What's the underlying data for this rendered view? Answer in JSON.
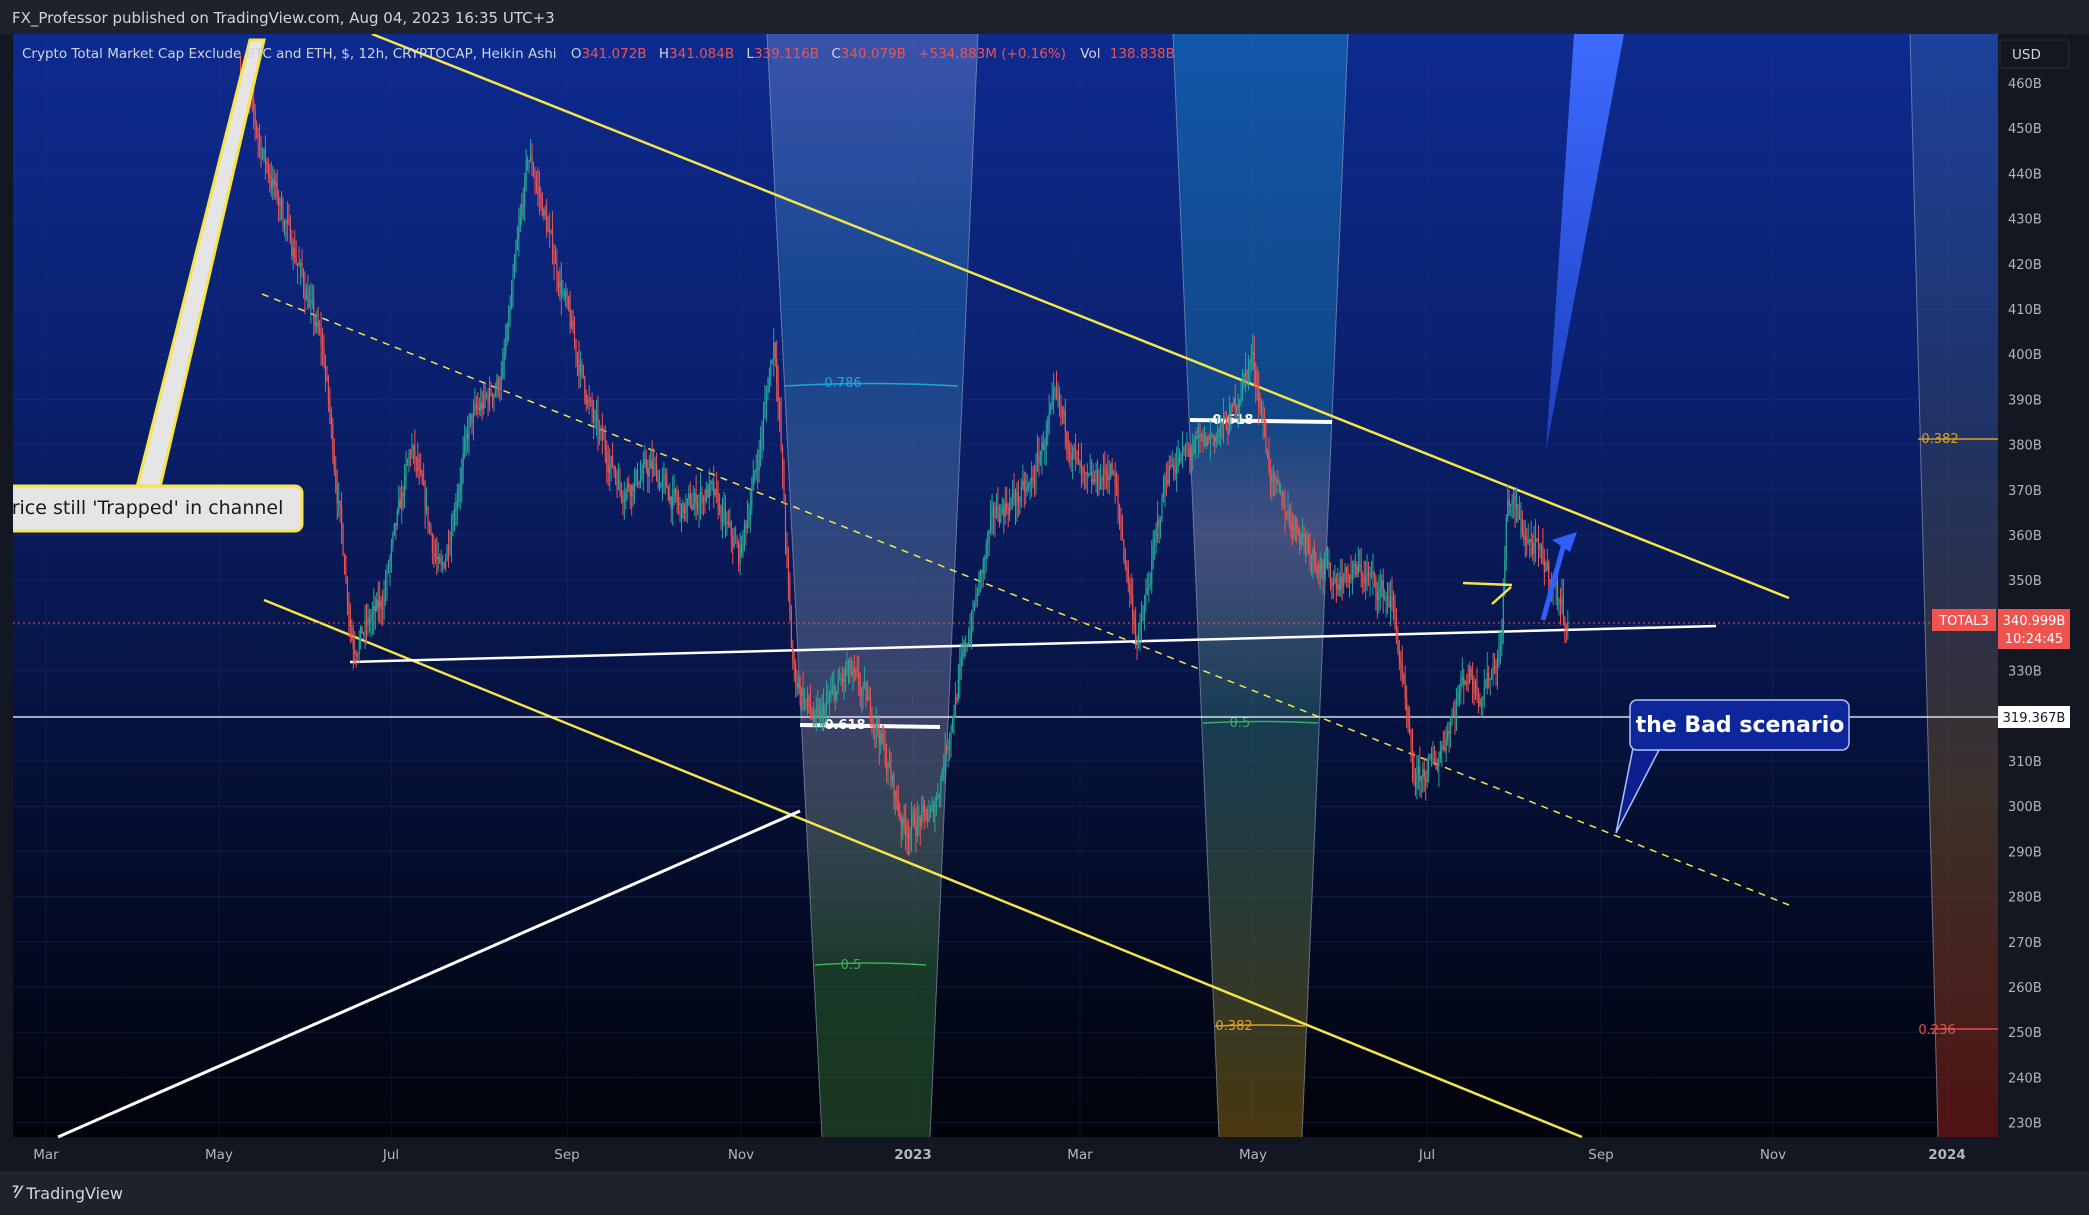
{
  "publisher": "FX_Professor published on TradingView.com, Aug 04, 2023 16:35 UTC+3",
  "footer_brand": "TradingView",
  "icons": {
    "brand": "tradingview-logo-icon"
  },
  "legend": {
    "title": "Crypto Total Market Cap Exclude BTC and ETH, $, 12h, CRYPTOCAP, Heikin Ashi",
    "o_label": "O",
    "o_value": "341.072B",
    "h_label": "H",
    "h_value": "341.084B",
    "l_label": "L",
    "l_value": "339.116B",
    "c_label": "C",
    "c_value": "340.079B",
    "change": "+534.883M (+0.16%)",
    "vol_label": "Vol",
    "vol_value": "138.838B"
  },
  "currency": "USD",
  "price_tag": {
    "symbol": "TOTAL3",
    "value": "340.999B",
    "countdown": "10:24:45"
  },
  "hline_tag": "319.367B",
  "annotations": {
    "trapped": "Price still 'Trapped' in channel",
    "bad": "the Bad scenario"
  },
  "fib_labels": {
    "a786": "0.786",
    "a618": "0.618",
    "a5": "0.5",
    "b618": "0.618",
    "b5": "0.5",
    "b382": "0.382",
    "c382": "0.382",
    "c236": "0.236"
  },
  "colors": {
    "background_top": "#0d2a8f",
    "background_bottom": "#000000",
    "up": "#26a69a",
    "down": "#ef5350",
    "channel": "#f5e44a",
    "white_line": "#ffffff",
    "arrow": "#2962ff"
  },
  "chart_data": {
    "type": "candlestick",
    "title": "Crypto Total Market Cap Exclude BTC and ETH, $, 12h, CRYPTOCAP, Heikin Ashi",
    "x_ticks": [
      "Mar",
      "May",
      "Jul",
      "Sep",
      "Nov",
      "2023",
      "Mar",
      "May",
      "Jul",
      "Sep",
      "Nov",
      "2024"
    ],
    "y_ticks": [
      "460B",
      "450B",
      "440B",
      "430B",
      "420B",
      "410B",
      "400B",
      "390B",
      "380B",
      "370B",
      "360B",
      "350B",
      "340B",
      "330B",
      "320B",
      "310B",
      "300B",
      "290B",
      "280B",
      "270B",
      "260B",
      "250B",
      "240B",
      "230B"
    ],
    "ylim": [
      226,
      468
    ],
    "unit": "B USD",
    "price_path": [
      [
        "2022-05-08",
        462
      ],
      [
        "2022-05-15",
        445
      ],
      [
        "2022-05-25",
        425
      ],
      [
        "2022-06-05",
        400
      ],
      [
        "2022-06-15",
        335
      ],
      [
        "2022-06-25",
        345
      ],
      [
        "2022-07-05",
        380
      ],
      [
        "2022-07-15",
        350
      ],
      [
        "2022-07-25",
        385
      ],
      [
        "2022-08-05",
        395
      ],
      [
        "2022-08-14",
        445
      ],
      [
        "2022-08-25",
        415
      ],
      [
        "2022-09-05",
        385
      ],
      [
        "2022-09-15",
        370
      ],
      [
        "2022-09-25",
        375
      ],
      [
        "2022-10-05",
        365
      ],
      [
        "2022-10-15",
        370
      ],
      [
        "2022-10-25",
        355
      ],
      [
        "2022-11-01",
        380
      ],
      [
        "2022-11-06",
        405
      ],
      [
        "2022-11-12",
        330
      ],
      [
        "2022-11-20",
        318
      ],
      [
        "2022-12-01",
        330
      ],
      [
        "2022-12-10",
        320
      ],
      [
        "2022-12-20",
        295
      ],
      [
        "2022-12-30",
        298
      ],
      [
        "2023-01-10",
        335
      ],
      [
        "2023-01-20",
        365
      ],
      [
        "2023-02-01",
        370
      ],
      [
        "2023-02-10",
        390
      ],
      [
        "2023-02-20",
        370
      ],
      [
        "2023-03-01",
        375
      ],
      [
        "2023-03-10",
        335
      ],
      [
        "2023-03-20",
        375
      ],
      [
        "2023-04-01",
        380
      ],
      [
        "2023-04-10",
        385
      ],
      [
        "2023-04-18",
        400
      ],
      [
        "2023-04-25",
        370
      ],
      [
        "2023-05-05",
        360
      ],
      [
        "2023-05-15",
        350
      ],
      [
        "2023-05-25",
        352
      ],
      [
        "2023-06-05",
        345
      ],
      [
        "2023-06-12",
        305
      ],
      [
        "2023-06-20",
        310
      ],
      [
        "2023-06-30",
        330
      ],
      [
        "2023-07-05",
        325
      ],
      [
        "2023-07-12",
        335
      ],
      [
        "2023-07-14",
        370
      ],
      [
        "2023-07-20",
        360
      ],
      [
        "2023-07-28",
        352
      ],
      [
        "2023-08-04",
        340.079
      ]
    ],
    "last": {
      "open": 341.072,
      "high": 341.084,
      "low": 339.116,
      "close": 340.079
    },
    "horizontal_line": 319.367
  }
}
